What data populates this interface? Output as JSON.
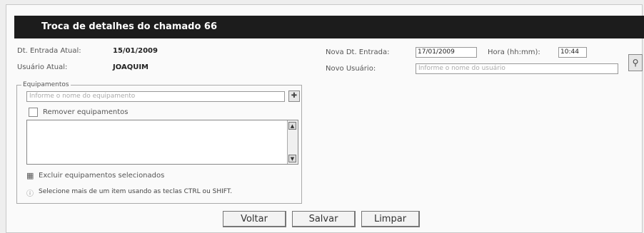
{
  "title": "Troca de detalhes do chamado 66",
  "current_date_label": "Dt. Entrada Atual:",
  "current_date_value": "15/01/2009",
  "current_user_label": "Usuário Atual:",
  "current_user_value": "JOAQUIM",
  "new_date_label": "Nova Dt. Entrada:",
  "new_date_value": "17/01/2009",
  "time_label": "Hora (hh:mm):",
  "time_value": "10:44",
  "new_user_label": "Novo Usuário:",
  "new_user_placeholder": "Informe o nome do usuário",
  "equipment": {
    "legend": "Equipamentos",
    "search_placeholder": "Informe o nome do equipamento",
    "remove_label": "Remover equipamentos",
    "exclude_label": "Excluir equipamentos selecionados",
    "hint_text": "Selecione mais de um item usando as teclas CTRL ou SHIFT."
  },
  "buttons": {
    "back": "Voltar",
    "save": "Salvar",
    "clear": "Limpar"
  }
}
